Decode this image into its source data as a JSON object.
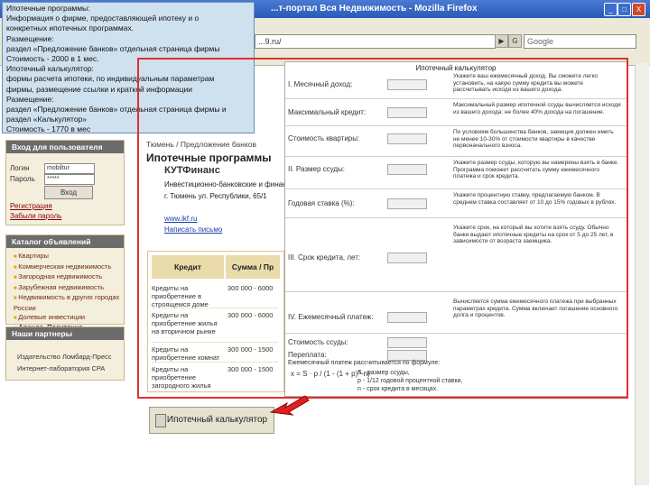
{
  "browser": {
    "title": "...т-портал Вся Недвижимость - Mozilla Firefox",
    "url": "...9.ru/",
    "search_placeholder": "Google",
    "window_buttons": [
      "_",
      "□",
      "X"
    ]
  },
  "tooltip": {
    "lines": [
      "Ипотечные программы:",
      " Информация о фирме, предоставляющей ипотеку и о",
      "конкретных ипотечных программах.",
      "Размещение:",
      "раздел «Предложение банков» отдельная страница фирмы",
      "Стоимость - 2000 в 1 мес.",
      " Ипотечный калькулятор:",
      "формы расчета ипотеки, по индивидуальным параметрам",
      "фирмы, размещение ссылки и краткой информации",
      "Размещение:",
      "раздел «Предложение банков» отдельная страница фирмы и",
      "раздел «Калькулятор»",
      "Стоимость - 1770 в мес"
    ]
  },
  "sidebar": {
    "login": {
      "title": "Вход для пользователя",
      "login_label": "Логин",
      "login_value": "mobiltur",
      "password_label": "Пароль",
      "password_value": "*****",
      "submit": "Вход",
      "links": [
        "Регистрация",
        "Забыли пароль"
      ]
    },
    "catalog": {
      "title": "Каталог объявлений",
      "items": [
        "Квартиры",
        "Коммерческая недвижимость",
        "Загородная недвижимость",
        "Зарубежная недвижимость",
        "Недвижимость в других городах России",
        "Долевые инвестиции",
        "Аренда. Посуточно"
      ]
    },
    "partners": {
      "title": "Наши партнеры",
      "items": [
        "Издательство Ломбард-Пресс",
        "Интернет-лаборатория CPA"
      ]
    }
  },
  "main": {
    "breadcrumb": "Тюмень / Предложение банков",
    "heading": "Ипотечные программы",
    "company": {
      "name": "КУТФинанс",
      "lines": [
        "Инвестиционно-банковские и финансовые",
        "г. Тюмень ул. Республики, 65/1",
        "www.ikf.ru",
        "Написать письмо"
      ]
    },
    "table": {
      "headers": [
        "Кредит",
        "Сумма / Пр"
      ],
      "rows": [
        {
          "name": "Кредиты на приобретение в строящемся доме",
          "sum": "300 000 - 6000"
        },
        {
          "name": "Кредиты на приобретение жилья на вторичном рынке",
          "sum": "300 000 - 6000"
        },
        {
          "name": "Кредиты на приобретение комнат",
          "sum": "300 000 - 1500"
        },
        {
          "name": "Кредиты на приобретение загородного жилья",
          "sum": "300 000 - 1500"
        }
      ]
    },
    "calc_button": "Ипотечный калькулятор"
  },
  "calculator": {
    "title": "Ипотечный калькулятор",
    "rows": [
      {
        "label": "I. Месячный доход:",
        "desc": "Укажите ваш ежемесячный доход. Вы сможете легко установить, на какую сумму кредита вы можете рассчитывать исходя из вашего дохода."
      },
      {
        "label": "Максимальный кредит:",
        "desc": "Максимальный размер ипотечной ссуды вычисляется исходя из вашего дохода: не более 40% дохода на погашение."
      },
      {
        "label": "Стоимость квартиры:",
        "desc": "По условиям большинства банков, заемщик должен иметь не менее 10-30% от стоимости квартиры в качестве первоначального взноса."
      },
      {
        "label": "II. Размер ссуды:",
        "desc": "Укажите размер ссуды, которую вы намерены взять в банке. Программа поможет рассчитать сумму ежемесячного платежа и срок кредита."
      },
      {
        "label": "Годовая ставка (%):",
        "desc": "Укажите процентную ставку, предлагаемую банком. В среднем ставка составляет от 10 до 15% годовых в рублях."
      },
      {
        "label": "III. Срок кредита, лет:",
        "desc": "Укажите срок, на который вы хотите взять ссуду. Обычно банки выдают ипотечные кредиты на срок от 5 до 25 лет, в зависимости от возраста заемщика."
      },
      {
        "label": "IV. Ежемесячный платеж:",
        "desc": "Вычисляется сумма ежемесячного платежа при выбранных параметрах кредита. Сумма включает погашение основного долга и процентов."
      },
      {
        "label": "Стоимость ссуды:",
        "desc": ""
      },
      {
        "label": "Переплата:",
        "desc": ""
      }
    ],
    "formula_label": "Ежемесячный платеж рассчитывается по формуле:",
    "formula": "x = S · p / (1 - (1 + p)^-n)",
    "formula_notes": [
      "S - размер ссуды,",
      "p - 1/12 годовой процентной ставки,",
      "n - срок кредита в месяцах."
    ]
  }
}
